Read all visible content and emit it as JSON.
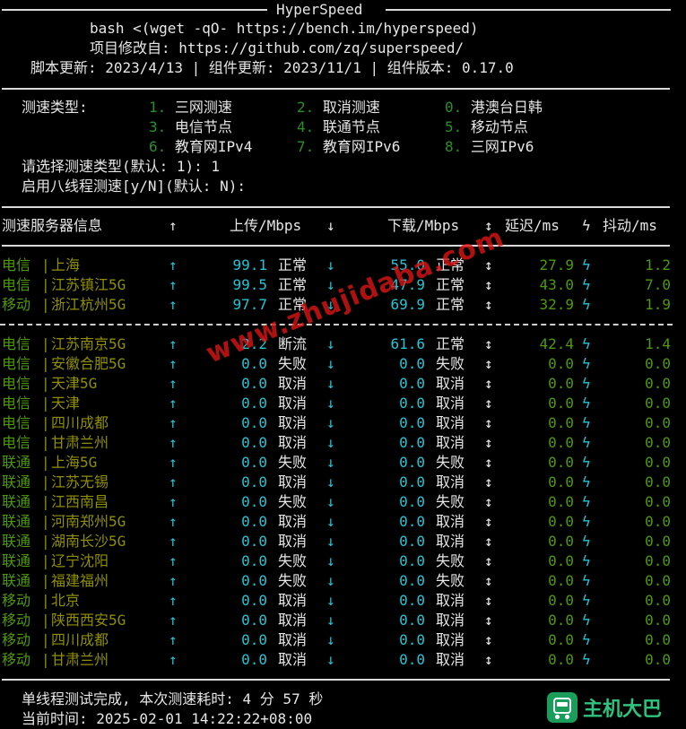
{
  "header": {
    "title": "HyperSpeed",
    "line1": "bash <(wget -qO- https://bench.im/hyperspeed)",
    "line2": "项目修改自: https://github.com/zq/superspeed/",
    "line3": "脚本更新: 2023/4/13 | 组件更新: 2023/11/1 | 组件版本: 0.17.0"
  },
  "menu": {
    "label": "测速类型:",
    "options": [
      {
        "num": "1.",
        "label": "三网测速"
      },
      {
        "num": "2.",
        "label": "取消测速"
      },
      {
        "num": "0.",
        "label": "港澳台日韩"
      },
      {
        "num": "3.",
        "label": "电信节点"
      },
      {
        "num": "4.",
        "label": "联通节点"
      },
      {
        "num": "5.",
        "label": "移动节点"
      },
      {
        "num": "6.",
        "label": "教育网IPv4"
      },
      {
        "num": "7.",
        "label": "教育网IPv6"
      },
      {
        "num": "8.",
        "label": "三网IPv6"
      }
    ],
    "prompt1": "请选择测速类型(默认: 1): 1",
    "prompt2": "启用八线程测速[y/N](默认: N):"
  },
  "table": {
    "headers": {
      "server": "测速服务器信息",
      "up_arrow": "↑",
      "upload": "上传/Mbps",
      "down_arrow": "↓",
      "download": "下载/Mbps",
      "both_arrow": "↕",
      "latency": "延迟/ms",
      "bolt": "ϟ",
      "jitter": "抖动/ms"
    },
    "rows_top": [
      {
        "isp": "电信",
        "loc": "上海",
        "up": "99.1",
        "up_st": "正常",
        "down": "55.0",
        "down_st": "正常",
        "lat": "27.9",
        "jit": "1.2"
      },
      {
        "isp": "电信",
        "loc": "江苏镇江5G",
        "up": "99.5",
        "up_st": "正常",
        "down": "47.9",
        "down_st": "正常",
        "lat": "43.0",
        "jit": "7.0"
      },
      {
        "isp": "移动",
        "loc": "浙江杭州5G",
        "up": "97.7",
        "up_st": "正常",
        "down": "69.9",
        "down_st": "正常",
        "lat": "32.9",
        "jit": "1.9"
      }
    ],
    "rows_bottom": [
      {
        "isp": "电信",
        "loc": "江苏南京5G",
        "up": "2.2",
        "up_st": "断流",
        "down": "61.6",
        "down_st": "正常",
        "lat": "42.4",
        "jit": "1.4"
      },
      {
        "isp": "电信",
        "loc": "安徽合肥5G",
        "up": "0.0",
        "up_st": "失败",
        "down": "0.0",
        "down_st": "失败",
        "lat": "0.0",
        "jit": "0.0"
      },
      {
        "isp": "电信",
        "loc": "天津5G",
        "up": "0.0",
        "up_st": "取消",
        "down": "0.0",
        "down_st": "取消",
        "lat": "0.0",
        "jit": "0.0"
      },
      {
        "isp": "电信",
        "loc": "天津",
        "up": "0.0",
        "up_st": "取消",
        "down": "0.0",
        "down_st": "取消",
        "lat": "0.0",
        "jit": "0.0"
      },
      {
        "isp": "电信",
        "loc": "四川成都",
        "up": "0.0",
        "up_st": "取消",
        "down": "0.0",
        "down_st": "取消",
        "lat": "0.0",
        "jit": "0.0"
      },
      {
        "isp": "电信",
        "loc": "甘肃兰州",
        "up": "0.0",
        "up_st": "取消",
        "down": "0.0",
        "down_st": "取消",
        "lat": "0.0",
        "jit": "0.0"
      },
      {
        "isp": "联通",
        "loc": "上海5G",
        "up": "0.0",
        "up_st": "失败",
        "down": "0.0",
        "down_st": "失败",
        "lat": "0.0",
        "jit": "0.0"
      },
      {
        "isp": "联通",
        "loc": "江苏无锡",
        "up": "0.0",
        "up_st": "取消",
        "down": "0.0",
        "down_st": "取消",
        "lat": "0.0",
        "jit": "0.0"
      },
      {
        "isp": "联通",
        "loc": "江西南昌",
        "up": "0.0",
        "up_st": "失败",
        "down": "0.0",
        "down_st": "失败",
        "lat": "0.0",
        "jit": "0.0"
      },
      {
        "isp": "联通",
        "loc": "河南郑州5G",
        "up": "0.0",
        "up_st": "取消",
        "down": "0.0",
        "down_st": "取消",
        "lat": "0.0",
        "jit": "0.0"
      },
      {
        "isp": "联通",
        "loc": "湖南长沙5G",
        "up": "0.0",
        "up_st": "取消",
        "down": "0.0",
        "down_st": "取消",
        "lat": "0.0",
        "jit": "0.0"
      },
      {
        "isp": "联通",
        "loc": "辽宁沈阳",
        "up": "0.0",
        "up_st": "失败",
        "down": "0.0",
        "down_st": "失败",
        "lat": "0.0",
        "jit": "0.0"
      },
      {
        "isp": "联通",
        "loc": "福建福州",
        "up": "0.0",
        "up_st": "失败",
        "down": "0.0",
        "down_st": "失败",
        "lat": "0.0",
        "jit": "0.0"
      },
      {
        "isp": "移动",
        "loc": "北京",
        "up": "0.0",
        "up_st": "取消",
        "down": "0.0",
        "down_st": "取消",
        "lat": "0.0",
        "jit": "0.0"
      },
      {
        "isp": "移动",
        "loc": "陕西西安5G",
        "up": "0.0",
        "up_st": "取消",
        "down": "0.0",
        "down_st": "取消",
        "lat": "0.0",
        "jit": "0.0"
      },
      {
        "isp": "移动",
        "loc": "四川成都",
        "up": "0.0",
        "up_st": "取消",
        "down": "0.0",
        "down_st": "取消",
        "lat": "0.0",
        "jit": "0.0"
      },
      {
        "isp": "移动",
        "loc": "甘肃兰州",
        "up": "0.0",
        "up_st": "取消",
        "down": "0.0",
        "down_st": "取消",
        "lat": "0.0",
        "jit": "0.0"
      }
    ]
  },
  "footer": {
    "done": "单线程测试完成, 本次测速耗时: 4 分 57 秒",
    "time": "当前时间: 2025-02-01 14:22:22+08:00"
  },
  "watermark": "www.zhujidaba.com",
  "logo": {
    "text": "主机大巴",
    "icon": "bus-icon"
  },
  "colors": {
    "background": "#000000",
    "cyan": "#22c6d6",
    "green": "#4e9a06",
    "olive": "#8f8f00",
    "watermark": "#dc1414",
    "logo": "#1a9c5a"
  }
}
